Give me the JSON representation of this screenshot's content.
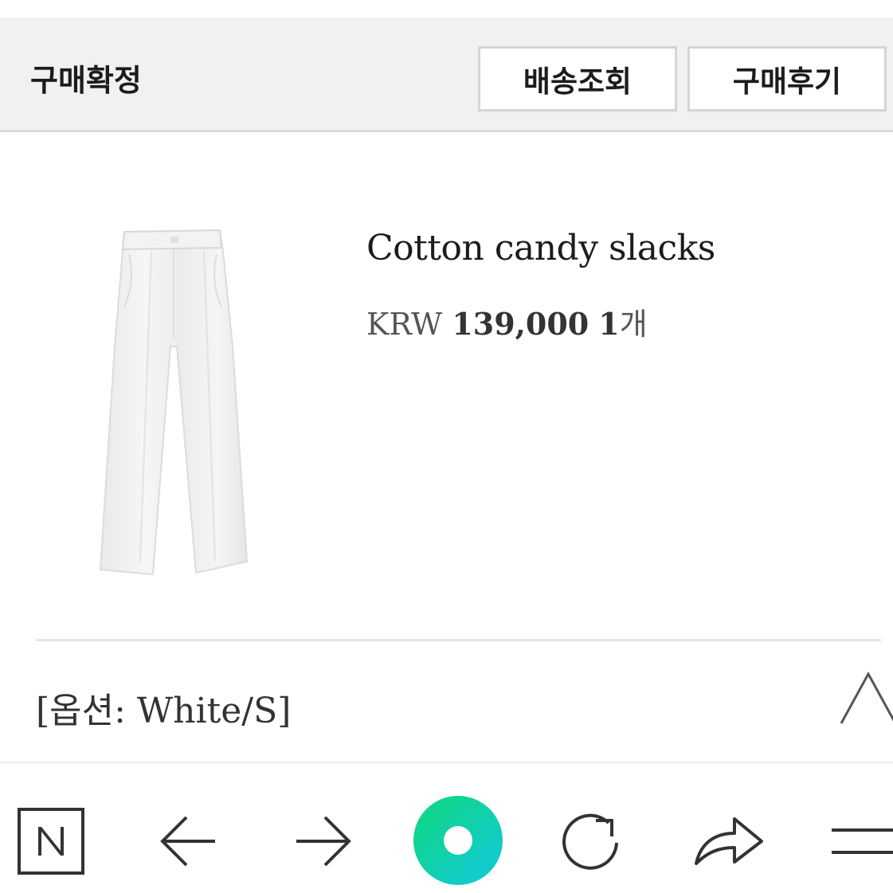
{
  "order_status": {
    "label": "구매확정",
    "buttons": {
      "tracking": "배송조회",
      "review": "구매후기"
    }
  },
  "product": {
    "name": "Cotton candy slacks",
    "currency": "KRW",
    "price": "139,000",
    "quantity": "1",
    "quantity_unit": "개",
    "option": "[옵션: White/S]"
  },
  "browser_nav": {
    "icons": [
      "naver-icon",
      "back-arrow-icon",
      "forward-arrow-icon",
      "home-ring-icon",
      "refresh-icon",
      "share-icon",
      "menu-icon"
    ],
    "accent_gradient": [
      "#10d87a",
      "#12c8e0"
    ]
  }
}
